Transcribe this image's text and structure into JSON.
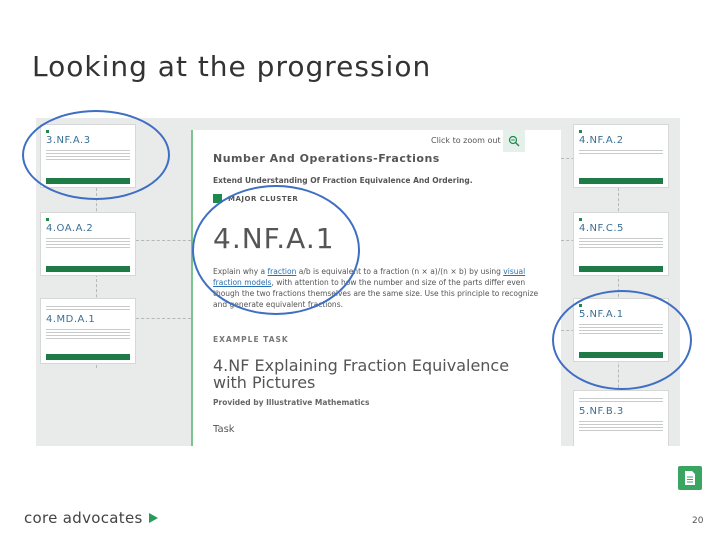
{
  "slide": {
    "title": "Looking at the progression",
    "page_number": "20",
    "brand": "core advocates"
  },
  "main": {
    "zoom_text": "Click to zoom out",
    "domain": "Number And Operations-Fractions",
    "cluster": "Extend Understanding Of Fraction Equivalence And Ordering.",
    "major_cluster": "MAJOR CLUSTER",
    "standard": "4.NF.A.1",
    "std_text_1": "Explain why a ",
    "std_link_1": "fraction",
    "std_text_2": " a/b is equivalent to a fraction (n × a)/(n × b) by using ",
    "std_link_2": "visual fraction models",
    "std_text_3": ", with attention to how the number and size of the parts differ even though the two fractions themselves are the same size. Use this principle to recognize and generate equivalent fractions.",
    "example_label": "EXAMPLE TASK",
    "task_title": "4.NF Explaining Fraction Equivalence with Pictures",
    "provider": "Provided by Illustrative Mathematics",
    "task_link": "Task"
  },
  "left_cards": [
    {
      "code": "3.NF.A.3"
    },
    {
      "code": "4.OA.A.2"
    },
    {
      "code": "4.MD.A.1"
    }
  ],
  "right_cards": [
    {
      "code": "4.NF.A.2"
    },
    {
      "code": "4.NF.C.5"
    },
    {
      "code": "5.NF.A.1"
    },
    {
      "code": "5.NF.B.3"
    }
  ],
  "icons": {
    "zoom": "zoom-out-icon",
    "play": "play-icon",
    "document": "document-icon"
  },
  "colors": {
    "accent_green": "#1d8a4c",
    "highlight_circle": "#3e6fc4",
    "link_blue": "#2a6fb0"
  }
}
